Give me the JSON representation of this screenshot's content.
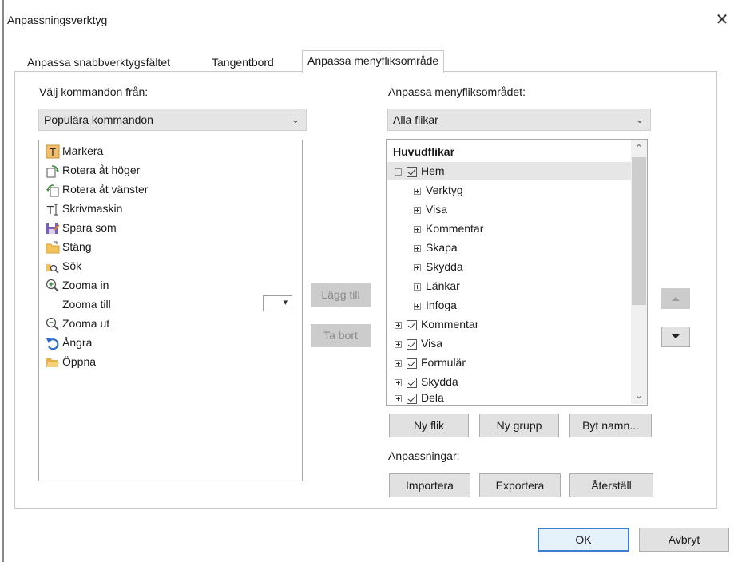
{
  "window": {
    "title": "Anpassningsverktyg",
    "close_glyph": "✕"
  },
  "tabs": [
    {
      "label": "Anpassa snabbverktygsfältet"
    },
    {
      "label": "Tangentbord"
    },
    {
      "label": "Anpassa menyfliksområde"
    }
  ],
  "left": {
    "label": "Välj kommandon från:",
    "combo_value": "Populära kommandon",
    "commands": [
      {
        "label": "Markera",
        "icon": "text-select-icon"
      },
      {
        "label": "Rotera åt höger",
        "icon": "rotate-right-icon"
      },
      {
        "label": "Rotera åt vänster",
        "icon": "rotate-left-icon"
      },
      {
        "label": "Skrivmaskin",
        "icon": "typewriter-icon"
      },
      {
        "label": "Spara som",
        "icon": "save-as-icon"
      },
      {
        "label": "Stäng",
        "icon": "close-folder-icon"
      },
      {
        "label": "Sök",
        "icon": "search-icon"
      },
      {
        "label": "Zooma in",
        "icon": "zoom-in-icon"
      },
      {
        "label": "Zooma till",
        "icon": ""
      },
      {
        "label": "Zooma ut",
        "icon": "zoom-out-icon"
      },
      {
        "label": "Ångra",
        "icon": "undo-icon"
      },
      {
        "label": "Öppna",
        "icon": "open-folder-icon"
      }
    ]
  },
  "middle": {
    "add_label": "Lägg till",
    "remove_label": "Ta bort"
  },
  "right": {
    "label": "Anpassa menyfliksområdet:",
    "combo_value": "Alla flikar",
    "tree_header": "Huvudflikar",
    "tree": [
      {
        "label": "Hem",
        "level": 0,
        "expanded": true,
        "checked": true
      },
      {
        "label": "Verktyg",
        "level": 1
      },
      {
        "label": "Visa",
        "level": 1
      },
      {
        "label": "Kommentar",
        "level": 1
      },
      {
        "label": "Skapa",
        "level": 1
      },
      {
        "label": "Skydda",
        "level": 1
      },
      {
        "label": "Länkar",
        "level": 1
      },
      {
        "label": "Infoga",
        "level": 1
      },
      {
        "label": "Kommentar",
        "level": 0,
        "expanded": false,
        "checked": true
      },
      {
        "label": "Visa",
        "level": 0,
        "expanded": false,
        "checked": true
      },
      {
        "label": "Formulär",
        "level": 0,
        "expanded": false,
        "checked": true
      },
      {
        "label": "Skydda",
        "level": 0,
        "expanded": false,
        "checked": true
      },
      {
        "label": "Dela",
        "level": 0,
        "expanded": false,
        "checked": true
      }
    ],
    "new_tab_label": "Ny flik",
    "new_group_label": "Ny grupp",
    "rename_label": "Byt namn...",
    "customizations_label": "Anpassningar:",
    "import_label": "Importera",
    "export_label": "Exportera",
    "reset_label": "Återställ"
  },
  "footer": {
    "ok_label": "OK",
    "cancel_label": "Avbryt"
  },
  "colors": {
    "accent": "#3c7fd1",
    "button_bg": "#e1e1e1",
    "disabled_bg": "#cccccc",
    "combo_bg": "#e5e5e5",
    "selected_row": "#e6e6e6"
  }
}
